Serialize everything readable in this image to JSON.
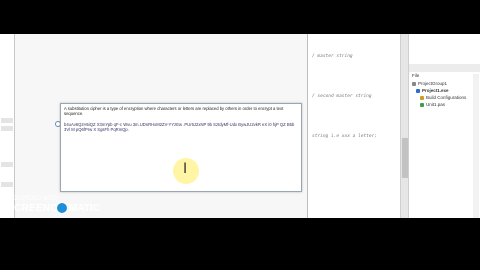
{
  "editor": {
    "comment_lines": [
      "/ master string",
      "/ second master string",
      "string i.e xxx a letter;"
    ]
  },
  "project_panel": {
    "header": "File",
    "items": [
      {
        "label": "ProjectGroup1",
        "color": "#888888"
      },
      {
        "label": "Project1.exe",
        "color": "#2a6fd0"
      },
      {
        "label": "Build Configurations",
        "color": "#d09a2a"
      },
      {
        "label": "Unit1.pas",
        "color": "#3aa04a"
      }
    ]
  },
  "dialog": {
    "intro_text": "A substitution cipher is a type of encryption where characters or letters are replaced by others in order to encrypt a text sequence.",
    "cipher_text": "b4uAv6QzH5iQZ X3mYpb qF-c Wvu 3m.UDnRHxM2ZV-YYzEw .PUr6J2xNP 9b SztdyMf-Udx BywJU2vkR eX i0 hjP QZ B5b3Vl M pQ6fPrw X SgsFh PqRmQp."
  },
  "watermark": {
    "top_text": "RECORDED WITH",
    "brand_left": "SCREENCAST",
    "brand_right": "MATIC"
  }
}
